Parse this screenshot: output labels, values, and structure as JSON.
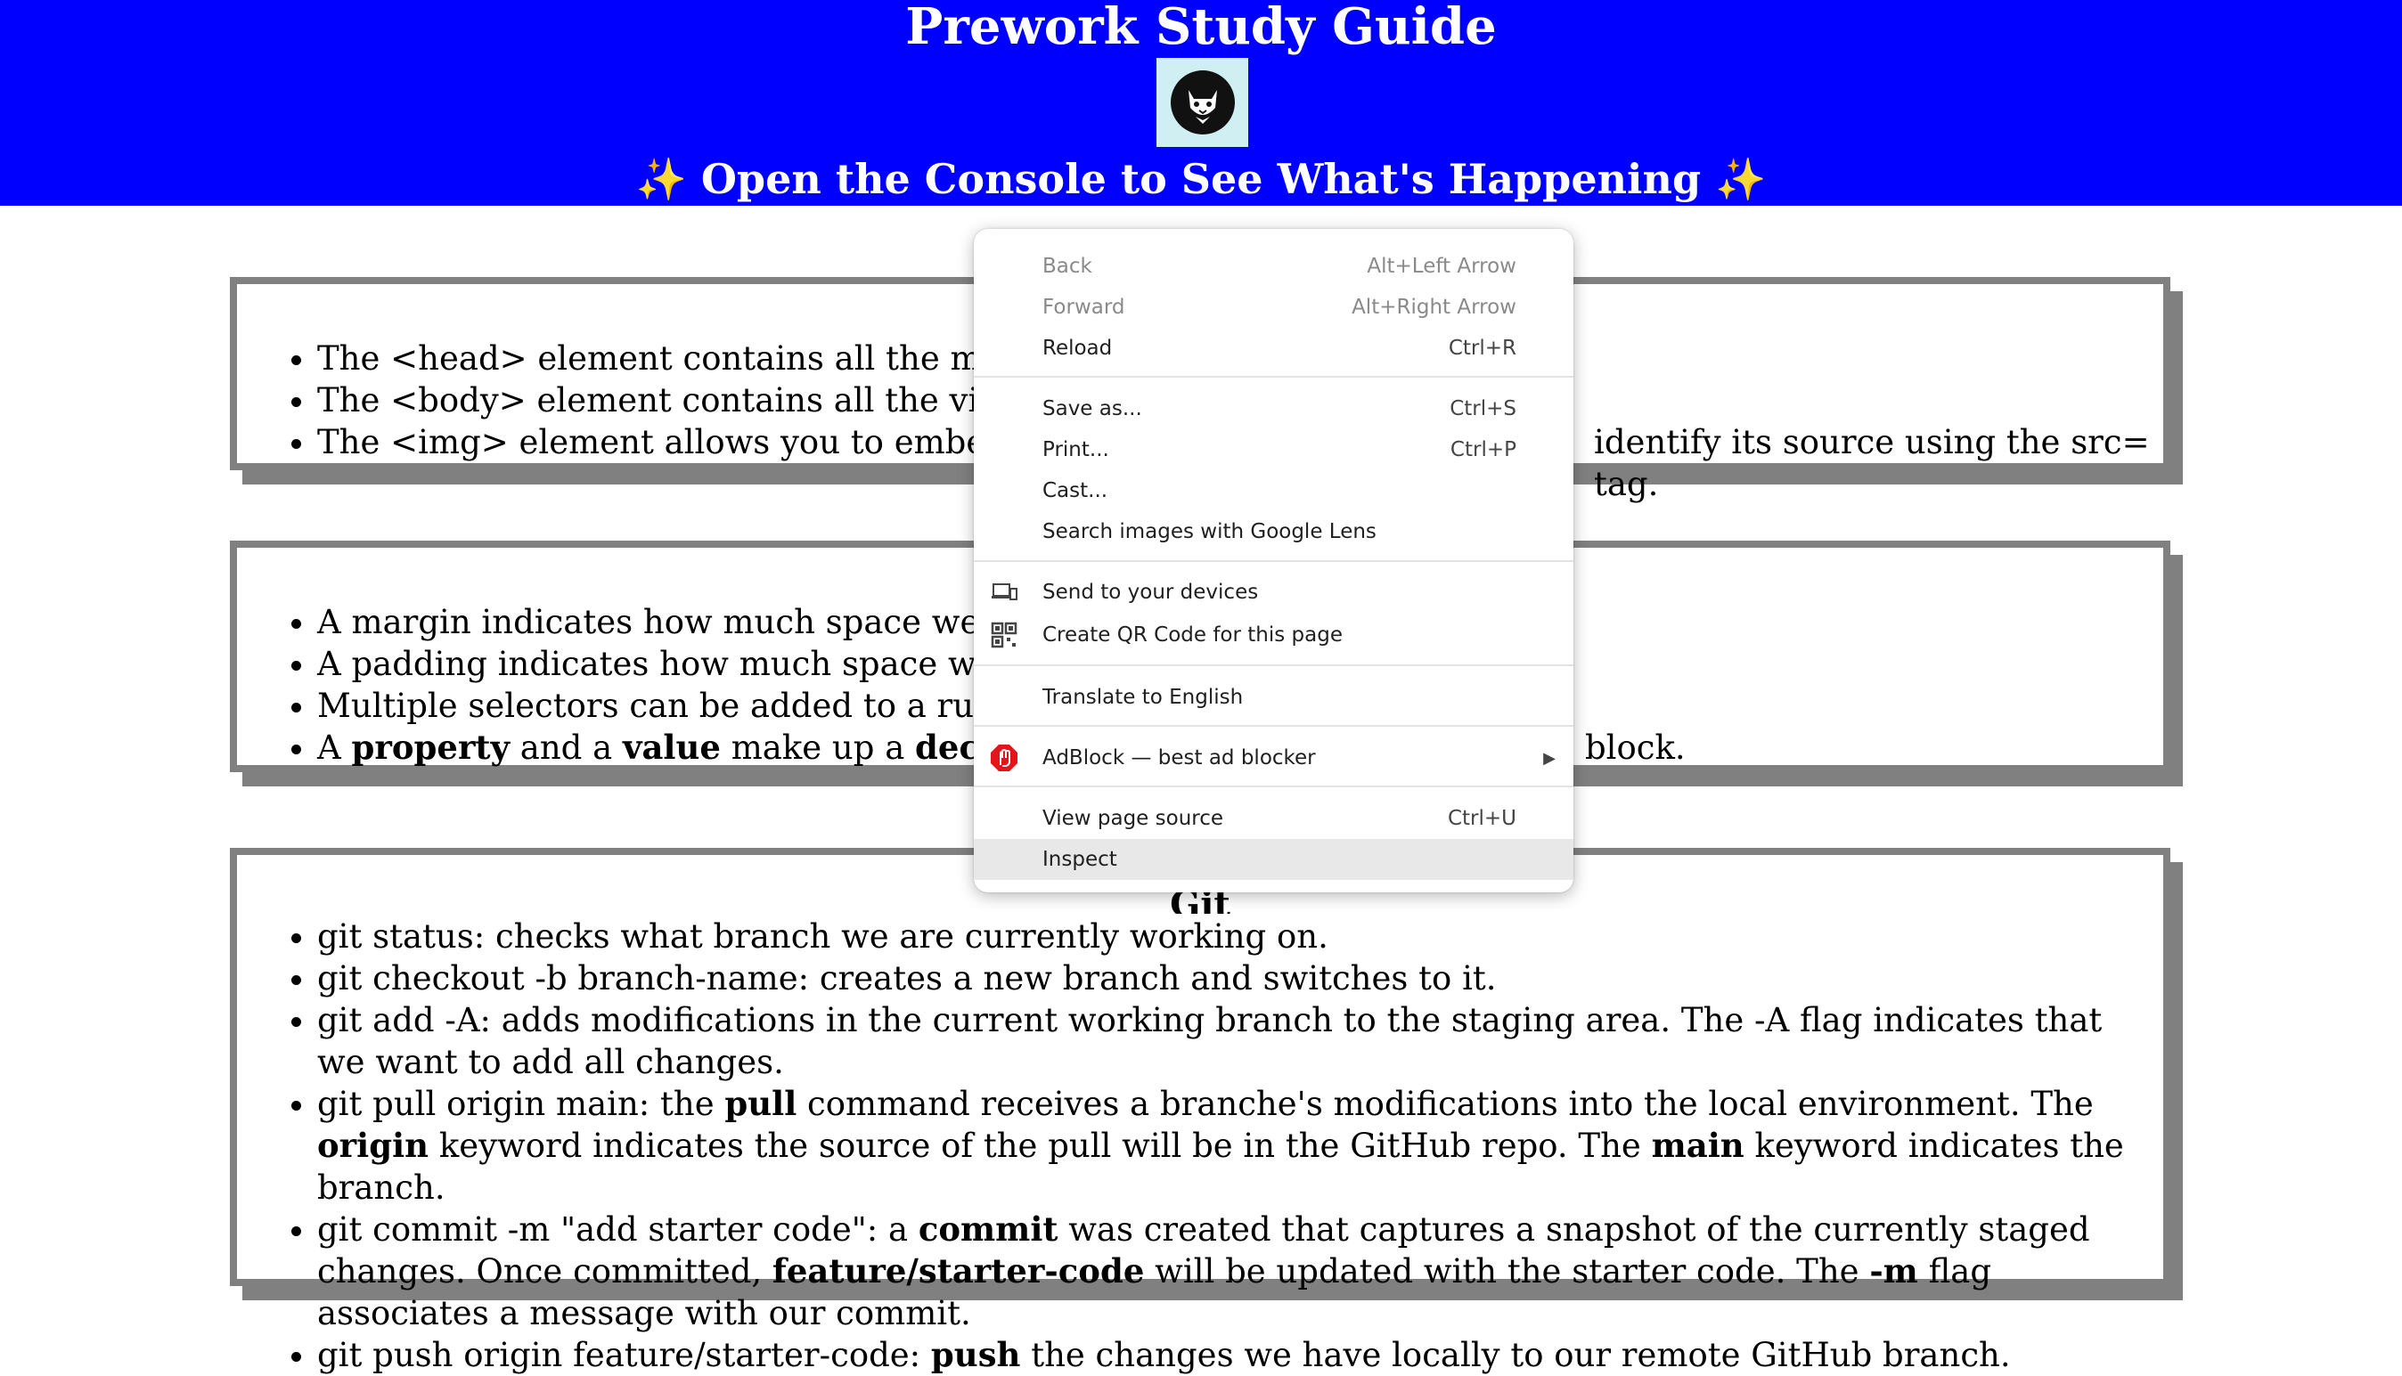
{
  "header": {
    "title": "Prework Study Guide",
    "subtitle_text": "Open the Console to See What's Happening",
    "sparkle": "✨",
    "bg_color": "#0000ff"
  },
  "sections": {
    "html": {
      "items": [
        "The <head> element contains all the metadata",
        "The <body> element contains all the visible el",
        "The <img> element allows you to embed an in"
      ],
      "item3_tail": "identify its source using the src= tag."
    },
    "css": {
      "items": [
        "A margin indicates how much space we want a",
        "A padding indicates how much space we want",
        "Multiple selectors can be added to a rule by sep"
      ],
      "item4": {
        "a": "A ",
        "b": "property",
        "c": " and a ",
        "d": "value",
        "e": " make up a ",
        "f": "declaratio",
        "tail": "block."
      }
    },
    "git": {
      "heading": "Git",
      "li1": "git status: checks what branch we are currently working on.",
      "li2": "git checkout -b branch-name: creates a new branch and switches to it.",
      "li3": "git add -A: adds modifications in the current working branch to the staging area. The -A flag indicates that we want to add all changes.",
      "li4": {
        "a": "git pull origin main: the ",
        "b": "pull",
        "c": " command receives a branche's modifications into the local environment. The ",
        "d": "origin",
        "e": " keyword indicates the source of the pull will be in the GitHub repo. The ",
        "f": "main",
        "g": " keyword indicates the branch."
      },
      "li5": {
        "a": "git commit -m \"add starter code\": a ",
        "b": "commit",
        "c": " was created that captures a snapshot of the currently staged changes. Once committed, ",
        "d": "feature/starter-code",
        "e": " will be updated with the starter code. The ",
        "f": "-m",
        "g": " flag associates a message with our commit."
      },
      "li6": {
        "a": "git push origin feature/starter-code: ",
        "b": "push",
        "c": " the changes we have locally to our remote GitHub branch."
      }
    }
  },
  "context_menu": {
    "back": {
      "label": "Back",
      "shortcut": "Alt+Left Arrow"
    },
    "forward": {
      "label": "Forward",
      "shortcut": "Alt+Right Arrow"
    },
    "reload": {
      "label": "Reload",
      "shortcut": "Ctrl+R"
    },
    "save_as": {
      "label": "Save as...",
      "shortcut": "Ctrl+S"
    },
    "print": {
      "label": "Print...",
      "shortcut": "Ctrl+P"
    },
    "cast": {
      "label": "Cast..."
    },
    "search_images": {
      "label": "Search images with Google Lens"
    },
    "send_devices": {
      "label": "Send to your devices",
      "icon": "devices-icon"
    },
    "qr_code": {
      "label": "Create QR Code for this page",
      "icon": "qr-code-icon"
    },
    "translate": {
      "label": "Translate to English"
    },
    "adblock": {
      "label": "AdBlock — best ad blocker",
      "icon": "adblock-icon",
      "icon_color": "#e4141b"
    },
    "view_source": {
      "label": "View page source",
      "shortcut": "Ctrl+U"
    },
    "inspect": {
      "label": "Inspect"
    }
  }
}
